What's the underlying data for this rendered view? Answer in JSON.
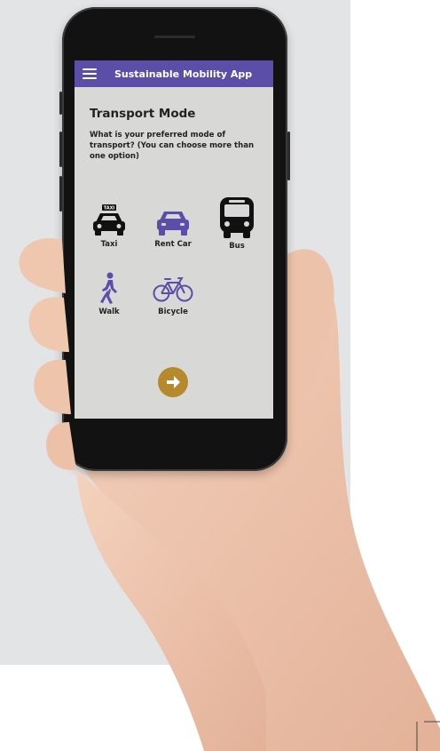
{
  "app": {
    "title": "Sustainable Mobility App"
  },
  "page": {
    "heading": "Transport Mode",
    "question": "What is your preferred mode of transport? (You can choose more than one option)"
  },
  "modes": [
    {
      "label": "Taxi",
      "icon": "taxi-icon",
      "color": "#111111"
    },
    {
      "label": "Rent Car",
      "icon": "car-icon",
      "color": "#5b4ea8"
    },
    {
      "label": "Bus",
      "icon": "bus-icon",
      "color": "#111111"
    },
    {
      "label": "Walk",
      "icon": "walk-icon",
      "color": "#5b4ea8"
    },
    {
      "label": "Bicycle",
      "icon": "bicycle-icon",
      "color": "#5b4ea8"
    }
  ],
  "taxi_sign": "TAXI",
  "colors": {
    "app_bar": "#5b4ea8",
    "next_button": "#b68a2c",
    "screen_bg": "#d8d9d6"
  }
}
